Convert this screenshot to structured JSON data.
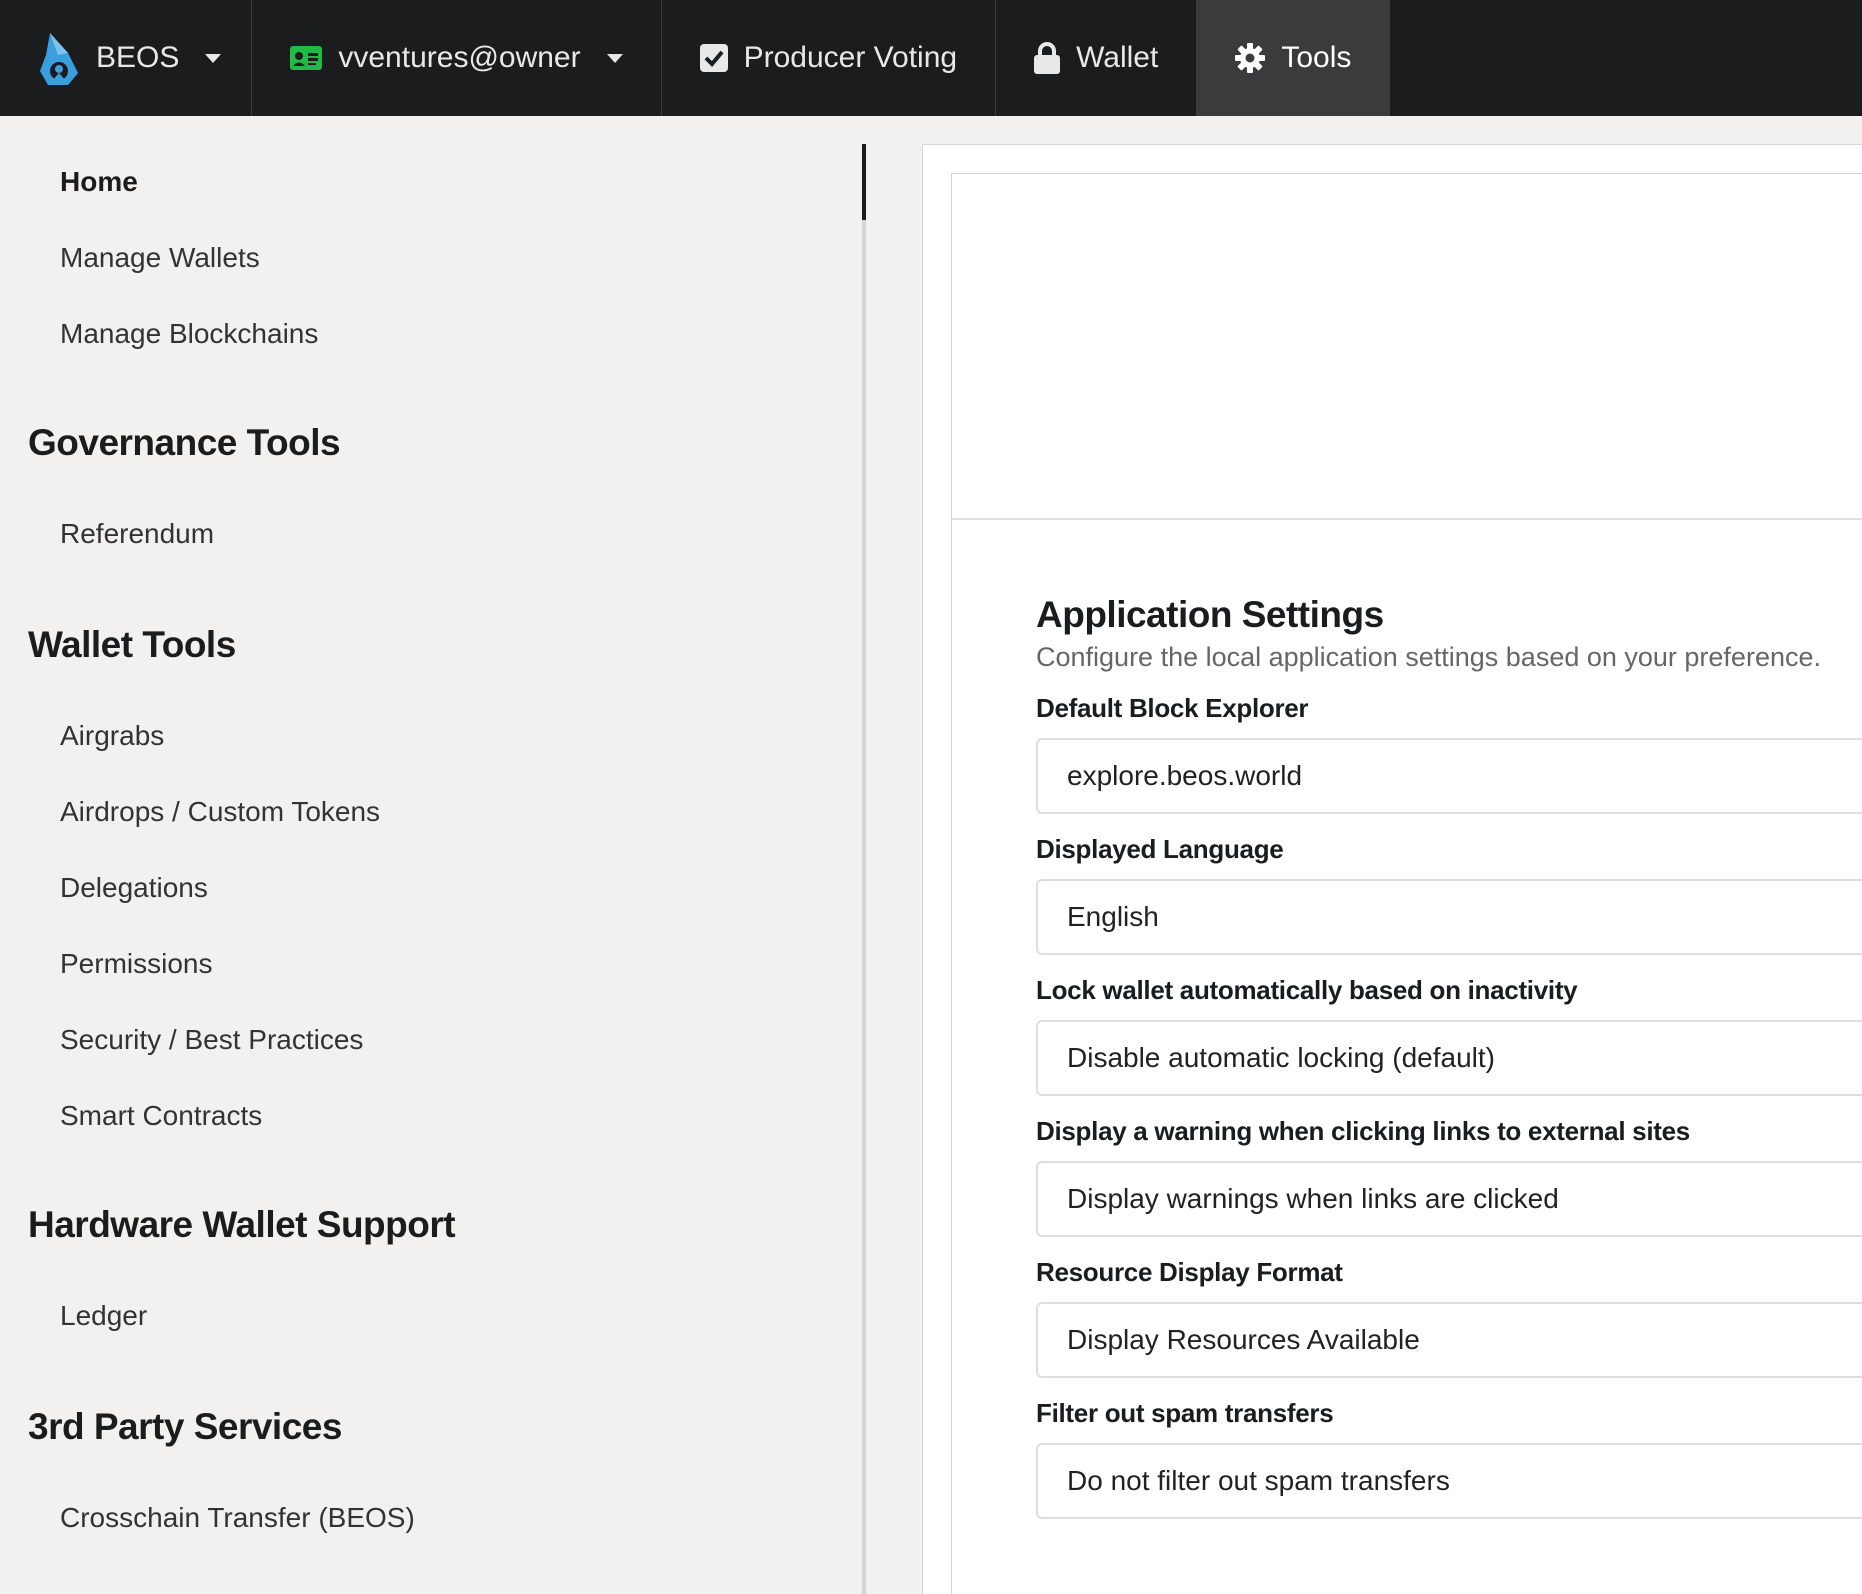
{
  "topbar": {
    "brand_label": "BEOS",
    "account_label": "vventures@owner",
    "voting_label": "Producer Voting",
    "wallet_label": "Wallet",
    "tools_label": "Tools",
    "colors": {
      "bar": "#1b1c1d",
      "active": "#3a3b3c",
      "brand_icon": "#3aa0dd",
      "account_icon": "#21ba45"
    },
    "icons": [
      "beos-logo-icon",
      "id-card-icon",
      "check-square-icon",
      "lock-icon",
      "gear-icon"
    ]
  },
  "sidebar": {
    "home": "Home",
    "manage_wallets": "Manage Wallets",
    "manage_blockchains": "Manage Blockchains",
    "governance_heading": "Governance Tools",
    "referendum": "Referendum",
    "wallet_tools_heading": "Wallet Tools",
    "airgrabs": "Airgrabs",
    "airdrops": "Airdrops / Custom Tokens",
    "delegations": "Delegations",
    "permissions": "Permissions",
    "security": "Security / Best Practices",
    "smart_contracts": "Smart Contracts",
    "hardware_heading": "Hardware Wallet Support",
    "ledger": "Ledger",
    "third_party_heading": "3rd Party Services",
    "crosschain": "Crosschain Transfer (BEOS)"
  },
  "settings": {
    "title": "Application Settings",
    "subtitle": "Configure the local application settings based on your preference.",
    "fields": [
      {
        "label": "Default Block Explorer",
        "value": "explore.beos.world"
      },
      {
        "label": "Displayed Language",
        "value": "English"
      },
      {
        "label": "Lock wallet automatically based on inactivity",
        "value": "Disable automatic locking (default)"
      },
      {
        "label": "Display a warning when clicking links to external sites",
        "value": "Display warnings when links are clicked"
      },
      {
        "label": "Resource Display Format",
        "value": "Display Resources Available"
      },
      {
        "label": "Filter out spam transfers",
        "value": "Do not filter out spam transfers"
      }
    ]
  }
}
